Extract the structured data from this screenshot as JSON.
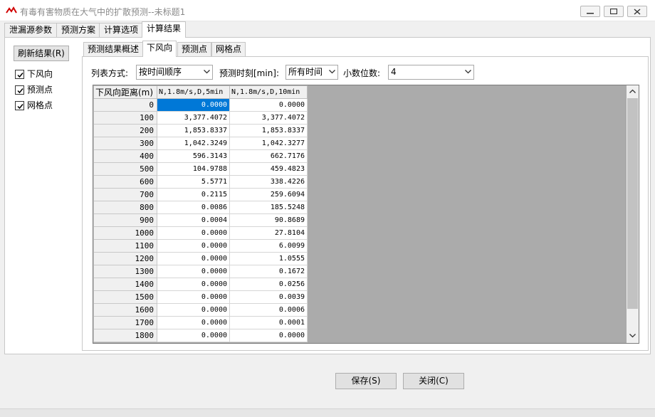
{
  "window": {
    "title": "有毒有害物质在大气中的扩散预测--未标题1"
  },
  "top_tabs": [
    {
      "label": "泄漏源参数"
    },
    {
      "label": "预测方案"
    },
    {
      "label": "计算选项"
    },
    {
      "label": "计算结果"
    }
  ],
  "left": {
    "refresh_label": "刷新结果(R)",
    "checkboxes": [
      {
        "label": "下风向",
        "checked": true
      },
      {
        "label": "预测点",
        "checked": true
      },
      {
        "label": "网格点",
        "checked": true
      }
    ]
  },
  "inner_tabs": [
    {
      "label": "预测结果概述"
    },
    {
      "label": "下风向"
    },
    {
      "label": "预测点"
    },
    {
      "label": "网格点"
    }
  ],
  "controls": {
    "list_mode_label": "列表方式:",
    "list_mode_value": "按时间顺序",
    "time_label": "预测时刻[min]:",
    "time_value": "所有时间",
    "decimals_label": "小数位数:",
    "decimals_value": "4"
  },
  "table": {
    "headers": [
      "下风向距离(m)",
      "N,1.8m/s,D,5min",
      "N,1.8m/s,D,10min"
    ],
    "rows": [
      [
        "0",
        "0.0000",
        "0.0000"
      ],
      [
        "100",
        "3,377.4072",
        "3,377.4072"
      ],
      [
        "200",
        "1,853.8337",
        "1,853.8337"
      ],
      [
        "300",
        "1,042.3249",
        "1,042.3277"
      ],
      [
        "400",
        "596.3143",
        "662.7176"
      ],
      [
        "500",
        "104.9788",
        "459.4823"
      ],
      [
        "600",
        "5.5771",
        "338.4226"
      ],
      [
        "700",
        "0.2115",
        "259.6094"
      ],
      [
        "800",
        "0.0086",
        "185.5248"
      ],
      [
        "900",
        "0.0004",
        "90.8689"
      ],
      [
        "1000",
        "0.0000",
        "27.8104"
      ],
      [
        "1100",
        "0.0000",
        "6.0099"
      ],
      [
        "1200",
        "0.0000",
        "1.0555"
      ],
      [
        "1300",
        "0.0000",
        "0.1672"
      ],
      [
        "1400",
        "0.0000",
        "0.0256"
      ],
      [
        "1500",
        "0.0000",
        "0.0039"
      ],
      [
        "1600",
        "0.0000",
        "0.0006"
      ],
      [
        "1700",
        "0.0000",
        "0.0001"
      ],
      [
        "1800",
        "0.0000",
        "0.0000"
      ]
    ]
  },
  "buttons": {
    "save_label": "保存(S)",
    "close_label": "关闭(C)"
  },
  "colors": {
    "selection": "#0078d7",
    "grid_background": "#ababab"
  },
  "icons": {
    "app": "app-logo-icon",
    "minimize": "minimize-icon",
    "maximize": "maximize-icon",
    "close": "close-icon",
    "dropdown": "chevron-down-icon",
    "check": "check-icon"
  }
}
